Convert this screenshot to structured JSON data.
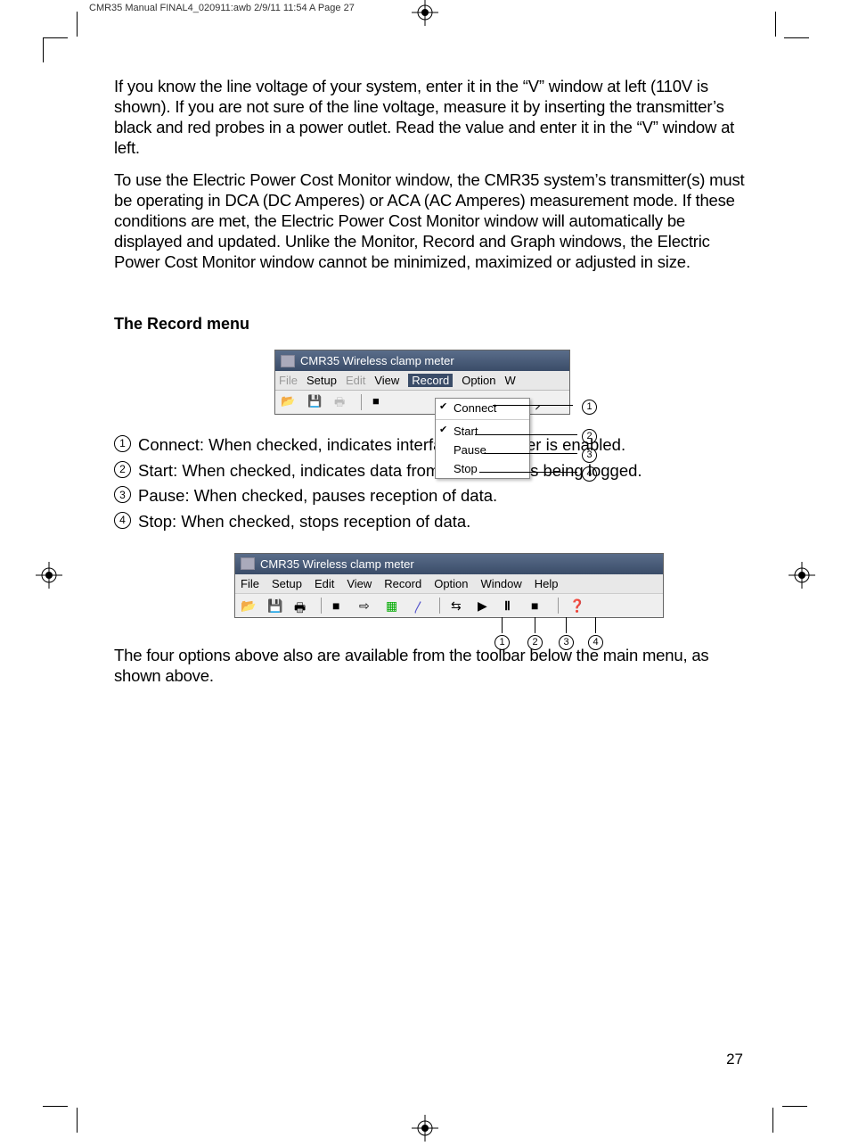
{
  "header": "CMR35 Manual FINAL4_020911:awb  2/9/11  11:54 A    Page 27",
  "para1": "If you know the line voltage of your system, enter it in the “V” window at left (110V is shown). If you are not sure of the line voltage, measure it by inserting the transmitter’s black and red probes in a power outlet. Read the value and enter it in the “V” window at left.",
  "para2": "To use the Electric Power Cost Monitor window, the CMR35 system’s transmitter(s) must be operating in DCA (DC Amperes) or ACA (AC Amperes) measurement mode. If these conditions are met, the Electric Power Cost Monitor window will automatically be displayed and updated. Unlike the Monitor, Record and Graph windows, the Electric Power Cost Monitor window cannot be minimized, maximized or adjusted in size.",
  "section_title": "The Record menu",
  "fig1": {
    "title": "CMR35 Wireless clamp meter",
    "menu": {
      "file": "File",
      "setup": "Setup",
      "edit": "Edit",
      "view": "View",
      "record": "Record",
      "option": "Option",
      "w": "W"
    },
    "dropdown": {
      "connect": "Connect",
      "start": "Start",
      "pause": "Pause",
      "stop": "Stop"
    }
  },
  "callouts": {
    "c1": "1",
    "c2": "2",
    "c3": "3",
    "c4": "4"
  },
  "list": {
    "i1": "Connect: When checked, indicates interface to receiver is enabled.",
    "i2": "Start: When checked, indicates data from transmitter is being logged.",
    "i3": "Pause: When checked, pauses reception of data.",
    "i4": "Stop: When checked, stops reception of data."
  },
  "fig2": {
    "title": "CMR35 Wireless clamp meter",
    "menu": {
      "file": "File",
      "setup": "Setup",
      "edit": "Edit",
      "view": "View",
      "record": "Record",
      "option": "Option",
      "window": "Window",
      "help": "Help"
    }
  },
  "para3": "The four options above also are available from the toolbar below the main menu, as shown above.",
  "page_number": "27"
}
